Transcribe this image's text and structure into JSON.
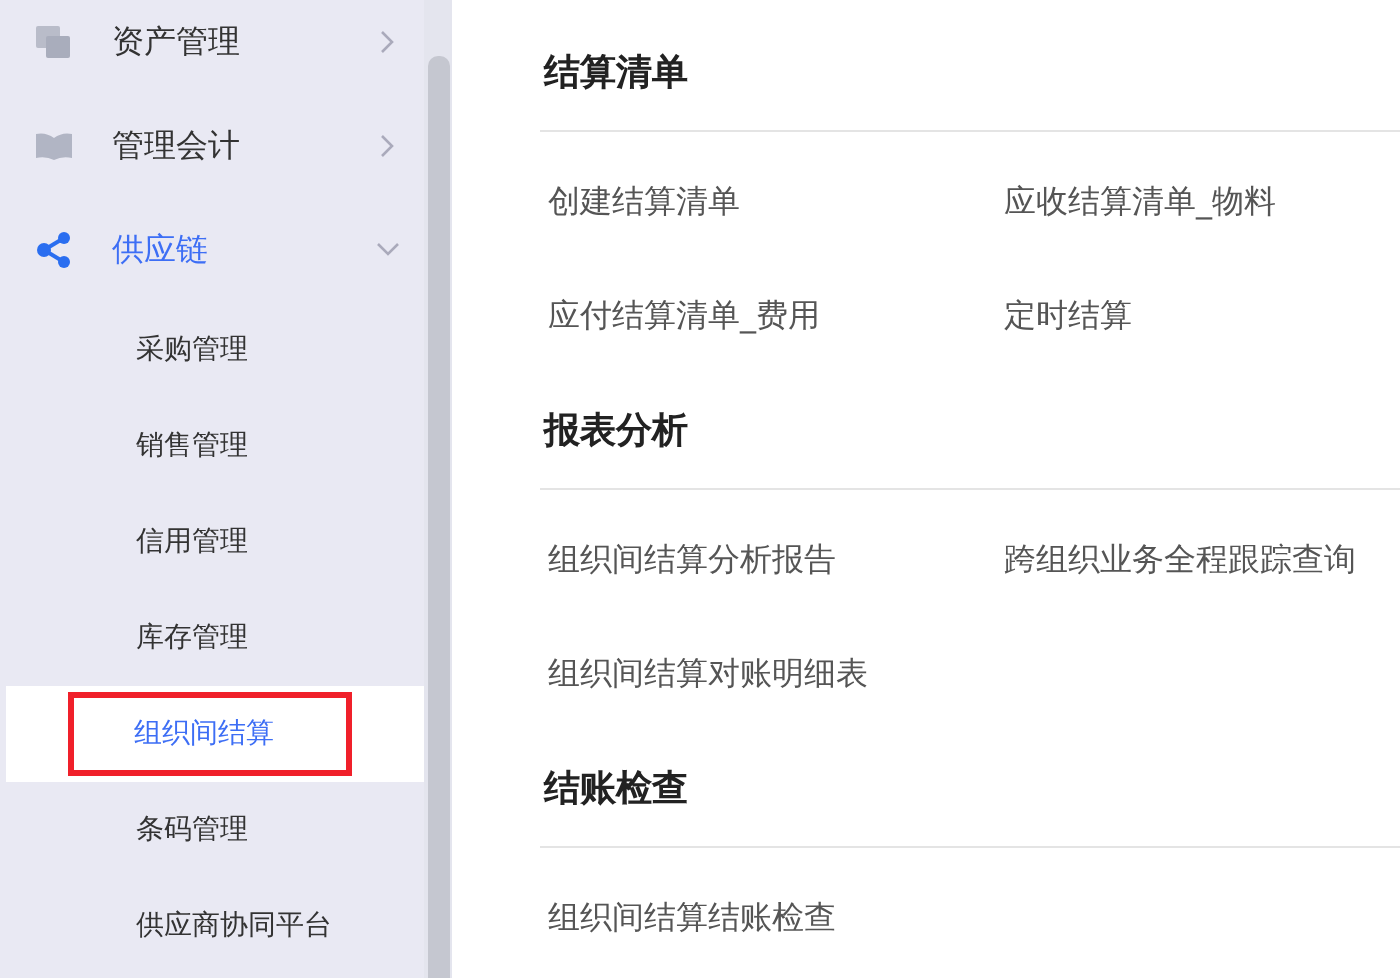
{
  "sidebar": {
    "items": [
      {
        "label": "资产管理",
        "kind": "stack",
        "expanded": false,
        "selected": false
      },
      {
        "label": "管理会计",
        "kind": "book",
        "expanded": false,
        "selected": false
      },
      {
        "label": "供应链",
        "kind": "share",
        "expanded": true,
        "selected": true,
        "children": [
          {
            "label": "采购管理",
            "selected": false,
            "highlighted": false
          },
          {
            "label": "销售管理",
            "selected": false,
            "highlighted": false
          },
          {
            "label": "信用管理",
            "selected": false,
            "highlighted": false
          },
          {
            "label": "库存管理",
            "selected": false,
            "highlighted": false
          },
          {
            "label": "组织间结算",
            "selected": true,
            "highlighted": true
          },
          {
            "label": "条码管理",
            "selected": false,
            "highlighted": false
          },
          {
            "label": "供应商协同平台",
            "selected": false,
            "highlighted": false
          }
        ]
      }
    ]
  },
  "sections": [
    {
      "title": "结算清单",
      "links": [
        "创建结算清单",
        "应收结算清单_物料",
        "应付结算清单_费用",
        "定时结算"
      ]
    },
    {
      "title": "报表分析",
      "links": [
        "组织间结算分析报告",
        "跨组织业务全程跟踪查询",
        "组织间结算对账明细表"
      ]
    },
    {
      "title": "结账检查",
      "links": [
        "组织间结算结账检查"
      ]
    }
  ]
}
